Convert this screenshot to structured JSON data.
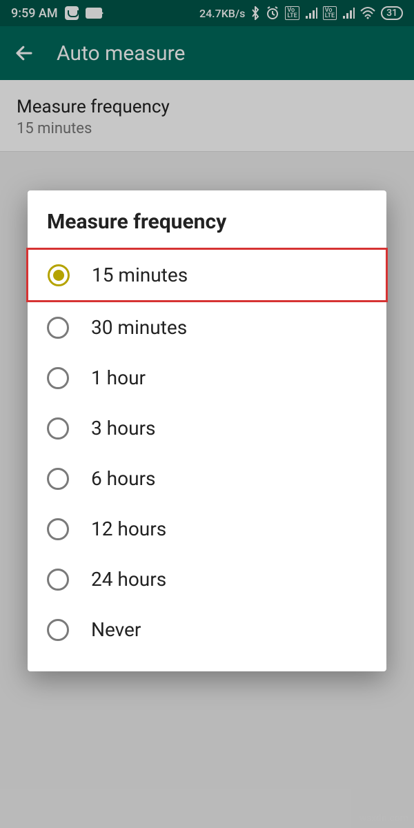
{
  "status": {
    "time": "9:59 AM",
    "net_speed": "24.7KB/s",
    "battery": "31"
  },
  "appbar": {
    "title": "Auto measure"
  },
  "setting": {
    "title": "Measure frequency",
    "value": "15 minutes"
  },
  "dialog": {
    "title": "Measure frequency",
    "options": [
      {
        "label": "15 minutes",
        "selected": true
      },
      {
        "label": "30 minutes",
        "selected": false
      },
      {
        "label": "1 hour",
        "selected": false
      },
      {
        "label": "3 hours",
        "selected": false
      },
      {
        "label": "6 hours",
        "selected": false
      },
      {
        "label": "12 hours",
        "selected": false
      },
      {
        "label": "24 hours",
        "selected": false
      },
      {
        "label": "Never",
        "selected": false
      }
    ]
  },
  "watermark": "wsxdn.com"
}
